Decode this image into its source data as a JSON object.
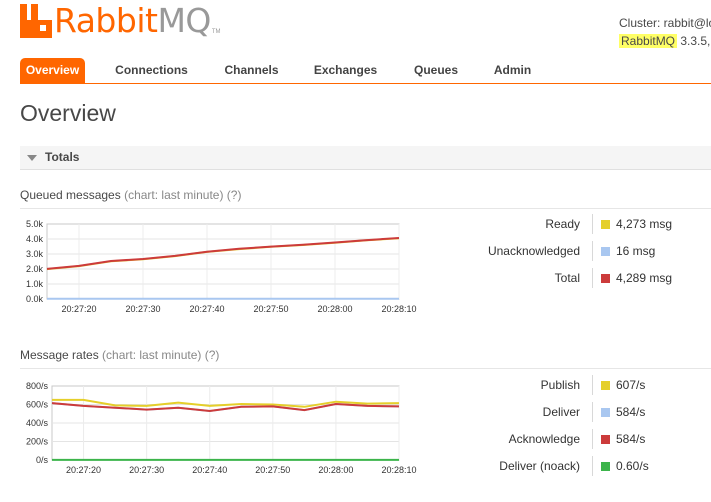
{
  "brand": {
    "rabbit": "Rabbit",
    "mq": "MQ",
    "tm": "TM"
  },
  "header": {
    "cluster_text": "Cluster: rabbit@lo",
    "product": "RabbitMQ",
    "version": " 3.3.5,"
  },
  "nav": {
    "tabs": [
      {
        "label": "Overview",
        "active": true
      },
      {
        "label": "Connections",
        "active": false
      },
      {
        "label": "Channels",
        "active": false
      },
      {
        "label": "Exchanges",
        "active": false
      },
      {
        "label": "Queues",
        "active": false
      },
      {
        "label": "Admin",
        "active": false
      }
    ]
  },
  "page": {
    "title": "Overview"
  },
  "totals": {
    "label": "Totals"
  },
  "queued": {
    "heading": "Queued messages",
    "hint": "(chart: last minute)",
    "help": "(?)",
    "legend": [
      {
        "label": "Ready",
        "value": "4,273 msg",
        "color": "#e5cf2a"
      },
      {
        "label": "Unacknowledged",
        "value": "16 msg",
        "color": "#a9c7f0"
      },
      {
        "label": "Total",
        "value": "4,289 msg",
        "color": "#cc3b3b"
      }
    ]
  },
  "rates": {
    "heading": "Message rates",
    "hint": "(chart: last minute)",
    "help": "(?)",
    "legend": [
      {
        "label": "Publish",
        "value": "607/s",
        "color": "#e5cf2a"
      },
      {
        "label": "Deliver",
        "value": "584/s",
        "color": "#a9c7f0"
      },
      {
        "label": "Acknowledge",
        "value": "584/s",
        "color": "#cc3b3b"
      },
      {
        "label": "Deliver (noack)",
        "value": "0.60/s",
        "color": "#3cb44b"
      }
    ]
  },
  "chart_data": [
    {
      "type": "line",
      "title": "Queued messages",
      "x": [
        "20:27:15",
        "20:27:20",
        "20:27:25",
        "20:27:30",
        "20:27:35",
        "20:27:40",
        "20:27:45",
        "20:27:50",
        "20:27:55",
        "20:28:00",
        "20:28:05",
        "20:28:10"
      ],
      "xticks": [
        "20:27:20",
        "20:27:30",
        "20:27:40",
        "20:27:50",
        "20:28:00",
        "20:28:10"
      ],
      "yticks": [
        "0.0k",
        "1.0k",
        "2.0k",
        "3.0k",
        "4.0k",
        "5.0k"
      ],
      "ylim": [
        0,
        5000
      ],
      "series": [
        {
          "name": "Ready",
          "color": "#e5cf2a",
          "values": [
            1990,
            2190,
            2520,
            2650,
            2860,
            3140,
            3330,
            3480,
            3600,
            3750,
            3910,
            4050
          ]
        },
        {
          "name": "Unacknowledged",
          "color": "#a9c7f0",
          "values": [
            16,
            16,
            16,
            16,
            16,
            16,
            16,
            16,
            16,
            16,
            16,
            16
          ]
        },
        {
          "name": "Total",
          "color": "#cc3b3b",
          "values": [
            2006,
            2206,
            2536,
            2666,
            2876,
            3156,
            3346,
            3496,
            3616,
            3766,
            3926,
            4066
          ]
        }
      ]
    },
    {
      "type": "line",
      "title": "Message rates",
      "x": [
        "20:27:15",
        "20:27:20",
        "20:27:25",
        "20:27:30",
        "20:27:35",
        "20:27:40",
        "20:27:45",
        "20:27:50",
        "20:27:55",
        "20:28:00",
        "20:28:05",
        "20:28:10"
      ],
      "xticks": [
        "20:27:20",
        "20:27:30",
        "20:27:40",
        "20:27:50",
        "20:28:00",
        "20:28:10"
      ],
      "yticks": [
        "0/s",
        "200/s",
        "400/s",
        "600/s",
        "800/s"
      ],
      "ylim": [
        0,
        800
      ],
      "series": [
        {
          "name": "Publish",
          "color": "#e5cf2a",
          "values": [
            650,
            650,
            590,
            585,
            620,
            585,
            605,
            600,
            575,
            630,
            610,
            615
          ]
        },
        {
          "name": "Deliver",
          "color": "#a9c7f0",
          "values": [
            615,
            585,
            565,
            545,
            565,
            530,
            575,
            580,
            540,
            605,
            585,
            580
          ]
        },
        {
          "name": "Acknowledge",
          "color": "#cc3b3b",
          "values": [
            615,
            585,
            565,
            545,
            565,
            530,
            575,
            580,
            540,
            605,
            585,
            580
          ]
        },
        {
          "name": "Deliver (noack)",
          "color": "#3cb44b",
          "values": [
            1,
            1,
            1,
            1,
            1,
            1,
            1,
            1,
            1,
            1,
            1,
            1
          ]
        }
      ]
    }
  ]
}
